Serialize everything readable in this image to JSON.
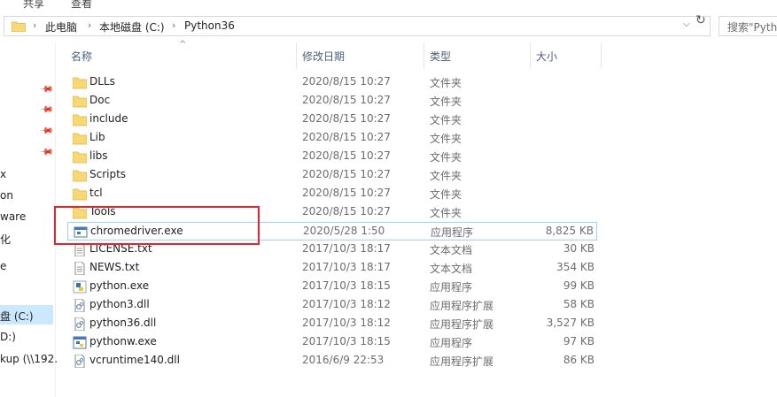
{
  "ribbon": {
    "share": "共享",
    "view": "查看"
  },
  "address": {
    "crumbs": [
      "此电脑",
      "本地磁盘 (C:)",
      "Python36"
    ],
    "search_placeholder": "搜索\"Pytho"
  },
  "nav": {
    "items": [
      "x",
      "on",
      "ware",
      "化",
      "e",
      "盘 (C:)",
      "D:)",
      "kup (\\\\192."
    ]
  },
  "columns": {
    "name": "名称",
    "date": "修改日期",
    "type": "类型",
    "size": "大小"
  },
  "files": [
    {
      "name": "DLLs",
      "date": "2020/8/15 10:27",
      "type": "文件夹",
      "size": "",
      "icon": "folder-icon"
    },
    {
      "name": "Doc",
      "date": "2020/8/15 10:27",
      "type": "文件夹",
      "size": "",
      "icon": "folder-icon"
    },
    {
      "name": "include",
      "date": "2020/8/15 10:27",
      "type": "文件夹",
      "size": "",
      "icon": "folder-icon"
    },
    {
      "name": "Lib",
      "date": "2020/8/15 10:27",
      "type": "文件夹",
      "size": "",
      "icon": "folder-icon"
    },
    {
      "name": "libs",
      "date": "2020/8/15 10:27",
      "type": "文件夹",
      "size": "",
      "icon": "folder-icon"
    },
    {
      "name": "Scripts",
      "date": "2020/8/15 10:27",
      "type": "文件夹",
      "size": "",
      "icon": "folder-icon"
    },
    {
      "name": "tcl",
      "date": "2020/8/15 10:27",
      "type": "文件夹",
      "size": "",
      "icon": "folder-icon"
    },
    {
      "name": "Tools",
      "date": "2020/8/15 10:27",
      "type": "文件夹",
      "size": "",
      "icon": "folder-icon"
    },
    {
      "name": "chromedriver.exe",
      "date": "2020/5/28 1:50",
      "type": "应用程序",
      "size": "8,825 KB",
      "icon": "app-window-icon",
      "selected": true
    },
    {
      "name": "LICENSE.txt",
      "date": "2017/10/3 18:17",
      "type": "文本文档",
      "size": "30 KB",
      "icon": "text-file-icon"
    },
    {
      "name": "NEWS.txt",
      "date": "2017/10/3 18:17",
      "type": "文本文档",
      "size": "354 KB",
      "icon": "text-file-icon"
    },
    {
      "name": "python.exe",
      "date": "2017/10/3 18:15",
      "type": "应用程序",
      "size": "99 KB",
      "icon": "python-icon"
    },
    {
      "name": "python3.dll",
      "date": "2017/10/3 18:12",
      "type": "应用程序扩展",
      "size": "58 KB",
      "icon": "dll-file-icon"
    },
    {
      "name": "python36.dll",
      "date": "2017/10/3 18:12",
      "type": "应用程序扩展",
      "size": "3,527 KB",
      "icon": "dll-file-icon"
    },
    {
      "name": "pythonw.exe",
      "date": "2017/10/3 18:15",
      "type": "应用程序",
      "size": "97 KB",
      "icon": "pythonw-icon"
    },
    {
      "name": "vcruntime140.dll",
      "date": "2016/6/9 22:53",
      "type": "应用程序扩展",
      "size": "86 KB",
      "icon": "dll-file-icon"
    }
  ],
  "colors": {
    "highlight": "#e8232b",
    "selection_border": "#99d1ff",
    "nav_selected": "#cce8ff",
    "folder": "#f8d775"
  }
}
